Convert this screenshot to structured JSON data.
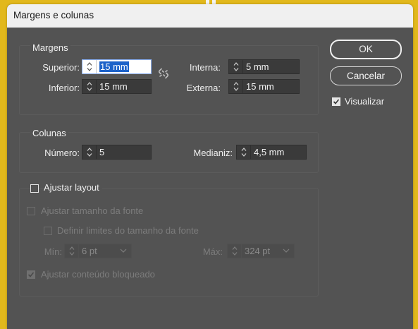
{
  "window": {
    "title": "Margens e colunas"
  },
  "margins": {
    "section_title": "Margens",
    "superior_label": "Superior:",
    "superior_value": "15 mm",
    "inferior_label": "Inferior:",
    "inferior_value": "15 mm",
    "interna_label": "Interna:",
    "interna_value": "5 mm",
    "externa_label": "Externa:",
    "externa_value": "15 mm",
    "link_icon": "broken-chain-icon"
  },
  "columns": {
    "section_title": "Colunas",
    "numero_label": "Número:",
    "numero_value": "5",
    "medianiz_label": "Medianiz:",
    "medianiz_value": "4,5 mm"
  },
  "layout": {
    "ajustar_layout_label": "Ajustar layout",
    "ajustar_layout_checked": false,
    "ajustar_fonte_label": "Ajustar tamanho da fonte",
    "ajustar_fonte_checked": false,
    "definir_limites_label": "Definir limites do tamanho da fonte",
    "definir_limites_checked": false,
    "min_label": "Mín:",
    "min_value": "6 pt",
    "max_label": "Máx:",
    "max_value": "324 pt",
    "ajustar_bloqueado_label": "Ajustar conteúdo bloqueado",
    "ajustar_bloqueado_checked": true
  },
  "buttons": {
    "ok": "OK",
    "cancel": "Cancelar"
  },
  "preview": {
    "label": "Visualizar",
    "checked": true
  },
  "colors": {
    "background": "#e2b81c",
    "dialog": "#535353",
    "field": "#3a3a3a",
    "selection": "#1c62c9"
  }
}
